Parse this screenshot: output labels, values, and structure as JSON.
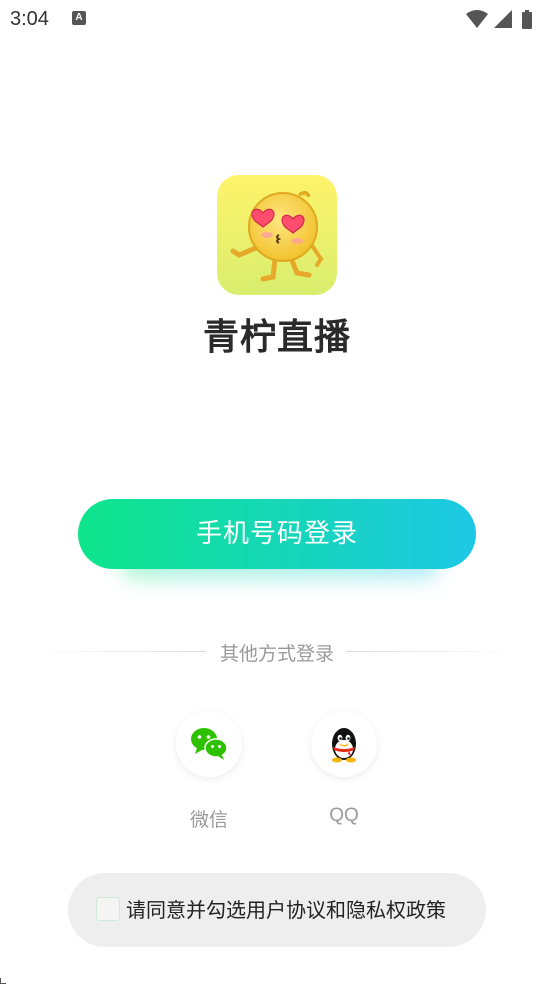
{
  "status_bar": {
    "time": "3:04",
    "notification_glyph": "A",
    "icons": [
      "wifi-icon",
      "signal-icon",
      "battery-icon"
    ]
  },
  "app": {
    "name": "青柠直播",
    "logo": "lemon-mascot-logo"
  },
  "login": {
    "phone_button_label": "手机号码登录",
    "other_methods_label": "其他方式登录",
    "social": [
      {
        "label": "微信",
        "icon": "wechat-icon"
      },
      {
        "label": "QQ",
        "icon": "qq-icon"
      }
    ]
  },
  "toast": {
    "text": "请同意并勾选用户协议和隐私权政策"
  },
  "colors": {
    "button_gradient_start": "#0ee58a",
    "button_gradient_end": "#1ec8e6",
    "wechat_green": "#2dc100",
    "text_gray": "#9a9a9a"
  }
}
